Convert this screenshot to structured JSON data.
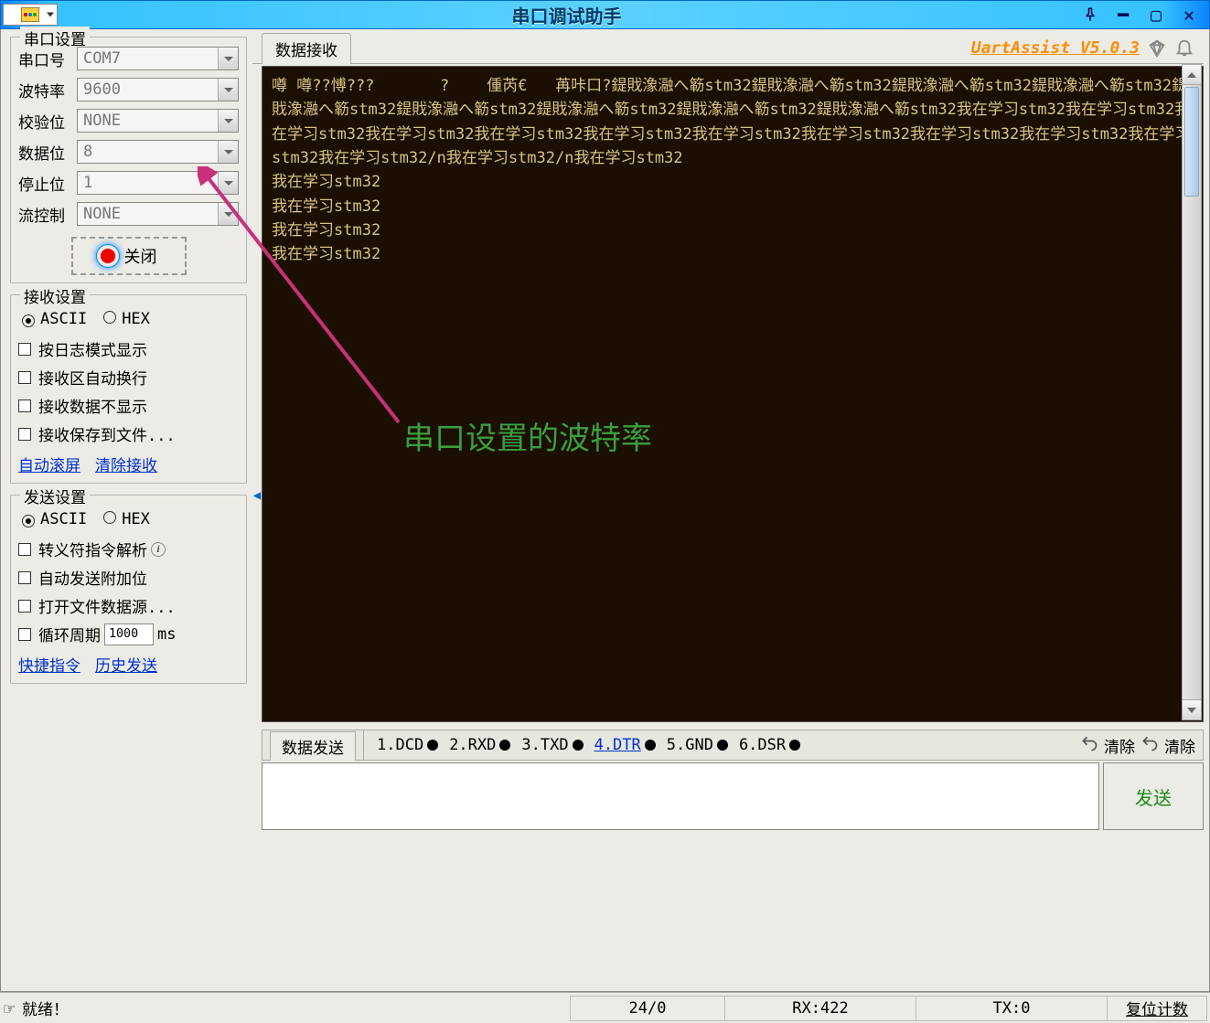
{
  "titlebar": {
    "title": "串口调试助手"
  },
  "port_settings": {
    "legend": "串口设置",
    "rows": {
      "port": {
        "label": "串口号",
        "value": "COM7"
      },
      "baud": {
        "label": "波特率",
        "value": "9600"
      },
      "parity": {
        "label": "校验位",
        "value": "NONE"
      },
      "data": {
        "label": "数据位",
        "value": "8"
      },
      "stop": {
        "label": "停止位",
        "value": "1"
      },
      "flow": {
        "label": "流控制",
        "value": "NONE"
      }
    },
    "close_btn": "关闭"
  },
  "recv_settings": {
    "legend": "接收设置",
    "mode": {
      "ascii": "ASCII",
      "hex": "HEX"
    },
    "checks": {
      "log_mode": "按日志模式显示",
      "auto_wrap": "接收区自动换行",
      "hide_recv": "接收数据不显示",
      "save_file": "接收保存到文件..."
    },
    "links": {
      "autoscroll": "自动滚屏",
      "clear": "清除接收"
    }
  },
  "send_settings": {
    "legend": "发送设置",
    "mode": {
      "ascii": "ASCII",
      "hex": "HEX"
    },
    "checks": {
      "escape": "转义符指令解析",
      "auto_extra": "自动发送附加位",
      "open_file": "打开文件数据源...",
      "cycle_label": "循环周期",
      "cycle_value": "1000",
      "cycle_unit": "ms"
    },
    "links": {
      "shortcut": "快捷指令",
      "history": "历史发送"
    }
  },
  "recv_tab": "数据接收",
  "brand": "UartAssist V5.0.3",
  "console_text": "噂 噂??愽???       ?    偅芮€   苒咔口?鍉戝潒瀜へ簕stm32鍉戝潒瀜へ簕stm32鍉戝潒瀜へ簕stm32鍉戝潒瀜へ簕stm32鍉戝潒瀜へ簕stm32鍉戝潒瀜へ簕stm32鍉戝潒瀜へ簕stm32鍉戝潒瀜へ簕stm32鍉戝潒瀜へ簕stm32我在学习stm32我在学习stm32我在学习stm32我在学习stm32我在学习stm32我在学习stm32我在学习stm32我在学习stm32我在学习stm32我在学习stm32我在学习stm32我在学习stm32/n我在学习stm32/n我在学习stm32\n我在学习stm32\n我在学习stm32\n我在学习stm32\n我在学习stm32",
  "annotation": "串口设置的波特率",
  "send_area": {
    "tab": "数据发送",
    "signals": [
      {
        "name": "1.DCD",
        "on": false,
        "link": false
      },
      {
        "name": "2.RXD",
        "on": false,
        "link": false
      },
      {
        "name": "3.TXD",
        "on": false,
        "link": false
      },
      {
        "name": "4.DTR",
        "on": true,
        "link": true
      },
      {
        "name": "5.GND",
        "on": false,
        "link": false
      },
      {
        "name": "6.DSR",
        "on": false,
        "link": false
      }
    ],
    "clear1": "清除",
    "clear2": "清除",
    "send_btn": "发送"
  },
  "statusbar": {
    "ready": "就绪！",
    "pos": "24/0",
    "rx": "RX:422",
    "tx": "TX:0",
    "reset": "复位计数"
  }
}
